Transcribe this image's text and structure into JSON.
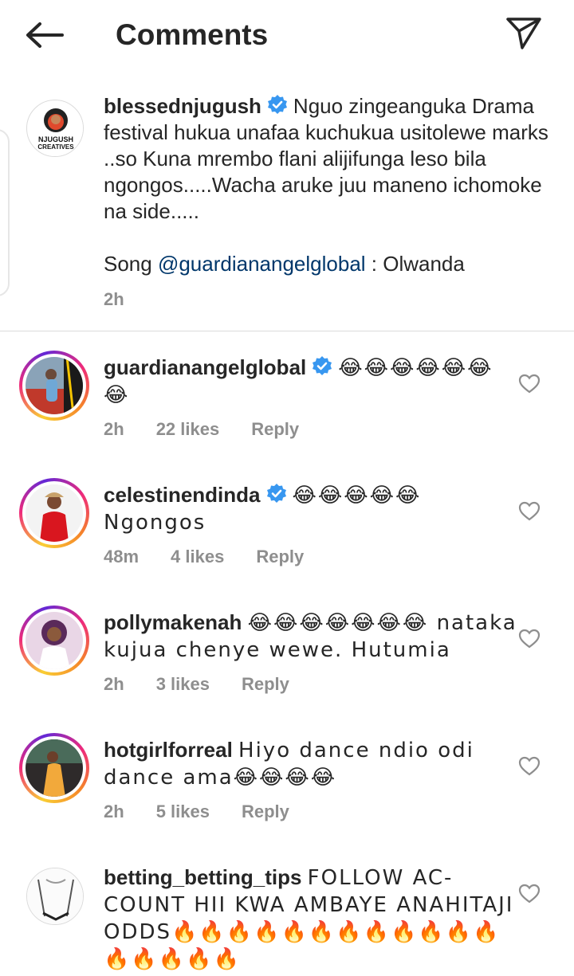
{
  "header": {
    "title": "Comments",
    "back_icon": "arrow-left-icon",
    "send_icon": "paper-plane-icon"
  },
  "caption": {
    "username": "blessednjugush",
    "verified": true,
    "text_lines": "Nguo zingeanguka Drama festival hukua unafaa kuchukua usitolewe marks ..so Kuna mrembo flani alijifunga leso bila ngongos.....Wacha aruke juu maneno ichomoke na side.....",
    "song_prefix": "Song ",
    "song_mention": "@guardianangelglobal",
    "song_suffix": " : Olwanda",
    "time": "2h",
    "avatar_text_1": "NJUGUSH",
    "avatar_text_2": "CREATIVES"
  },
  "comments": [
    {
      "username": "guardianangelglobal",
      "verified": true,
      "text": "😂😂😂😂😂😂😂",
      "time": "2h",
      "likes": "22 likes",
      "reply": "Reply"
    },
    {
      "username": "celestinendinda",
      "verified": true,
      "text": "😂😂😂😂😂 Ngongos",
      "time": "48m",
      "likes": "4 likes",
      "reply": "Reply"
    },
    {
      "username": "pollymakenah",
      "verified": false,
      "text": "😂😂😂😂😂😂😂 nataka kujua chenye wewe. Hutumia",
      "time": "2h",
      "likes": "3 likes",
      "reply": "Reply"
    },
    {
      "username": "hotgirlforreal",
      "verified": false,
      "text": "Hiyo dance ndio odi dance ama😂😂😂😂",
      "time": "2h",
      "likes": "5 likes",
      "reply": "Reply"
    },
    {
      "username": "betting_betting_tips",
      "verified": false,
      "text": "FOLLOW AC-COUNT HII KWA AMBAYE ANAHITAJI ODDS🔥🔥🔥🔥🔥🔥🔥🔥🔥🔥🔥🔥🔥🔥🔥🔥🔥"
    }
  ],
  "colors": {
    "text": "#262626",
    "muted": "#8e8e8e",
    "link": "#00376b",
    "verified": "#3897f0",
    "divider": "#dbdbdb"
  }
}
